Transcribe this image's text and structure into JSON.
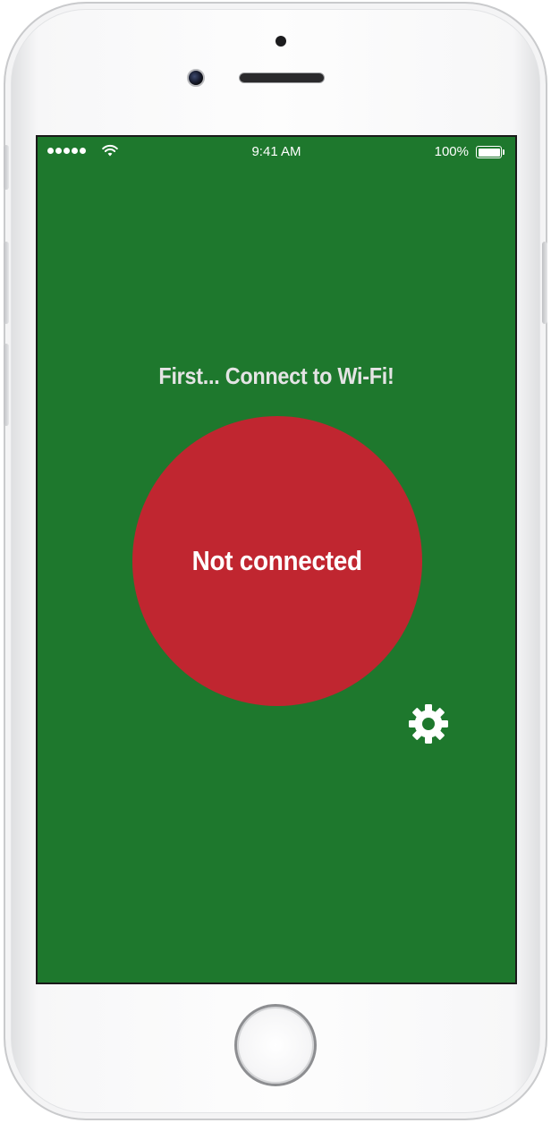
{
  "status_bar": {
    "time": "9:41 AM",
    "battery_percent": "100%",
    "battery_level": 1.0,
    "signal_dots": 5,
    "wifi_icon": "wifi-icon"
  },
  "main": {
    "headline": "First... Connect to Wi-Fi!",
    "connect_button_label": "Not connected",
    "settings_icon": "gear-icon"
  },
  "colors": {
    "background": "#1e782d",
    "connect_button": "#c02630",
    "headline_text": "#e4e4e4",
    "button_text": "#ffffff",
    "icon": "#ffffff"
  }
}
